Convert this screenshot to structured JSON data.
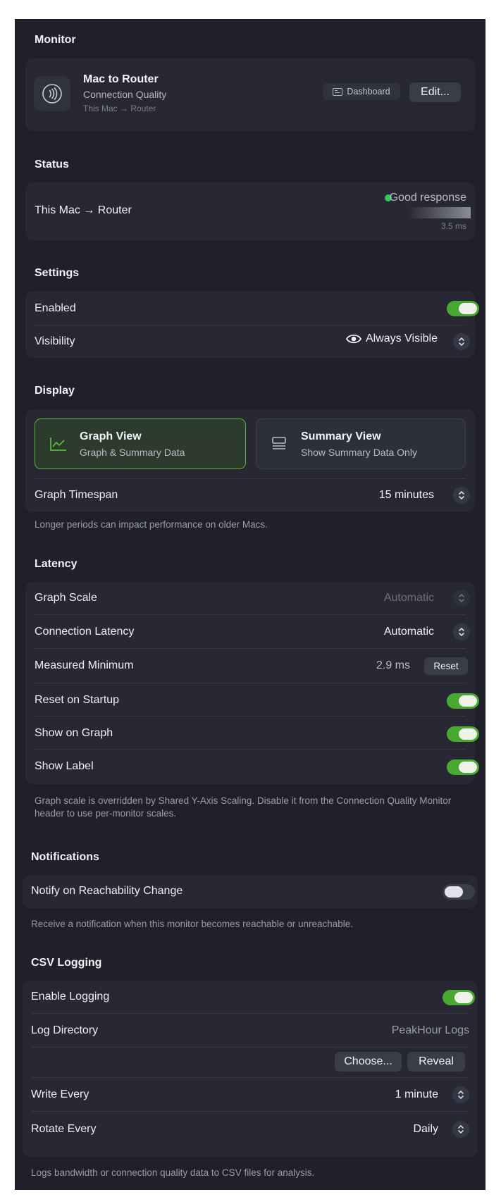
{
  "monitor": {
    "section_title": "Monitor",
    "name": "Mac to Router",
    "type": "Connection Quality",
    "route": "This Mac → Router",
    "dashboard_label": "Dashboard",
    "edit_label": "Edit..."
  },
  "status": {
    "section_title": "Status",
    "route": "This Mac → Router",
    "state": "Good response",
    "latency": "3.5 ms",
    "status_color": "#32c454"
  },
  "settings": {
    "section_title": "Settings",
    "enabled_label": "Enabled",
    "enabled": true,
    "visibility_label": "Visibility",
    "visibility_value": "Always Visible"
  },
  "display": {
    "section_title": "Display",
    "options": [
      {
        "title": "Graph View",
        "subtitle": "Graph & Summary Data",
        "selected": true
      },
      {
        "title": "Summary View",
        "subtitle": "Show Summary Data Only",
        "selected": false
      }
    ],
    "timespan_label": "Graph Timespan",
    "timespan_value": "15 minutes",
    "note": "Longer periods can impact performance on older Macs."
  },
  "latency": {
    "section_title": "Latency",
    "graph_scale_label": "Graph Scale",
    "graph_scale_value": "Automatic",
    "connection_latency_label": "Connection Latency",
    "connection_latency_value": "Automatic",
    "measured_minimum_label": "Measured Minimum",
    "measured_minimum_value": "2.9 ms",
    "reset_label": "Reset",
    "reset_on_startup_label": "Reset on Startup",
    "reset_on_startup": true,
    "show_on_graph_label": "Show on Graph",
    "show_on_graph": true,
    "show_label_label": "Show Label",
    "show_label": true,
    "note": "Graph scale is overridden by Shared Y-Axis Scaling. Disable it from the Connection Quality Monitor header to use per-monitor scales."
  },
  "notifications": {
    "section_title": "Notifications",
    "notify_label": "Notify on Reachability Change",
    "notify": false,
    "note": "Receive a notification when this monitor becomes reachable or unreachable."
  },
  "csv_logging": {
    "section_title": "CSV Logging",
    "enable_label": "Enable Logging",
    "enabled": true,
    "directory_label": "Log Directory",
    "directory_value": "PeakHour Logs",
    "choose_label": "Choose...",
    "reveal_label": "Reveal",
    "write_every_label": "Write Every",
    "write_every_value": "1 minute",
    "rotate_every_label": "Rotate Every",
    "rotate_every_value": "Daily",
    "note": "Logs bandwidth or connection quality data to CSV files for analysis."
  },
  "colors": {
    "accent_green": "#49a831",
    "background": "#1f2029",
    "card": "#272833"
  }
}
